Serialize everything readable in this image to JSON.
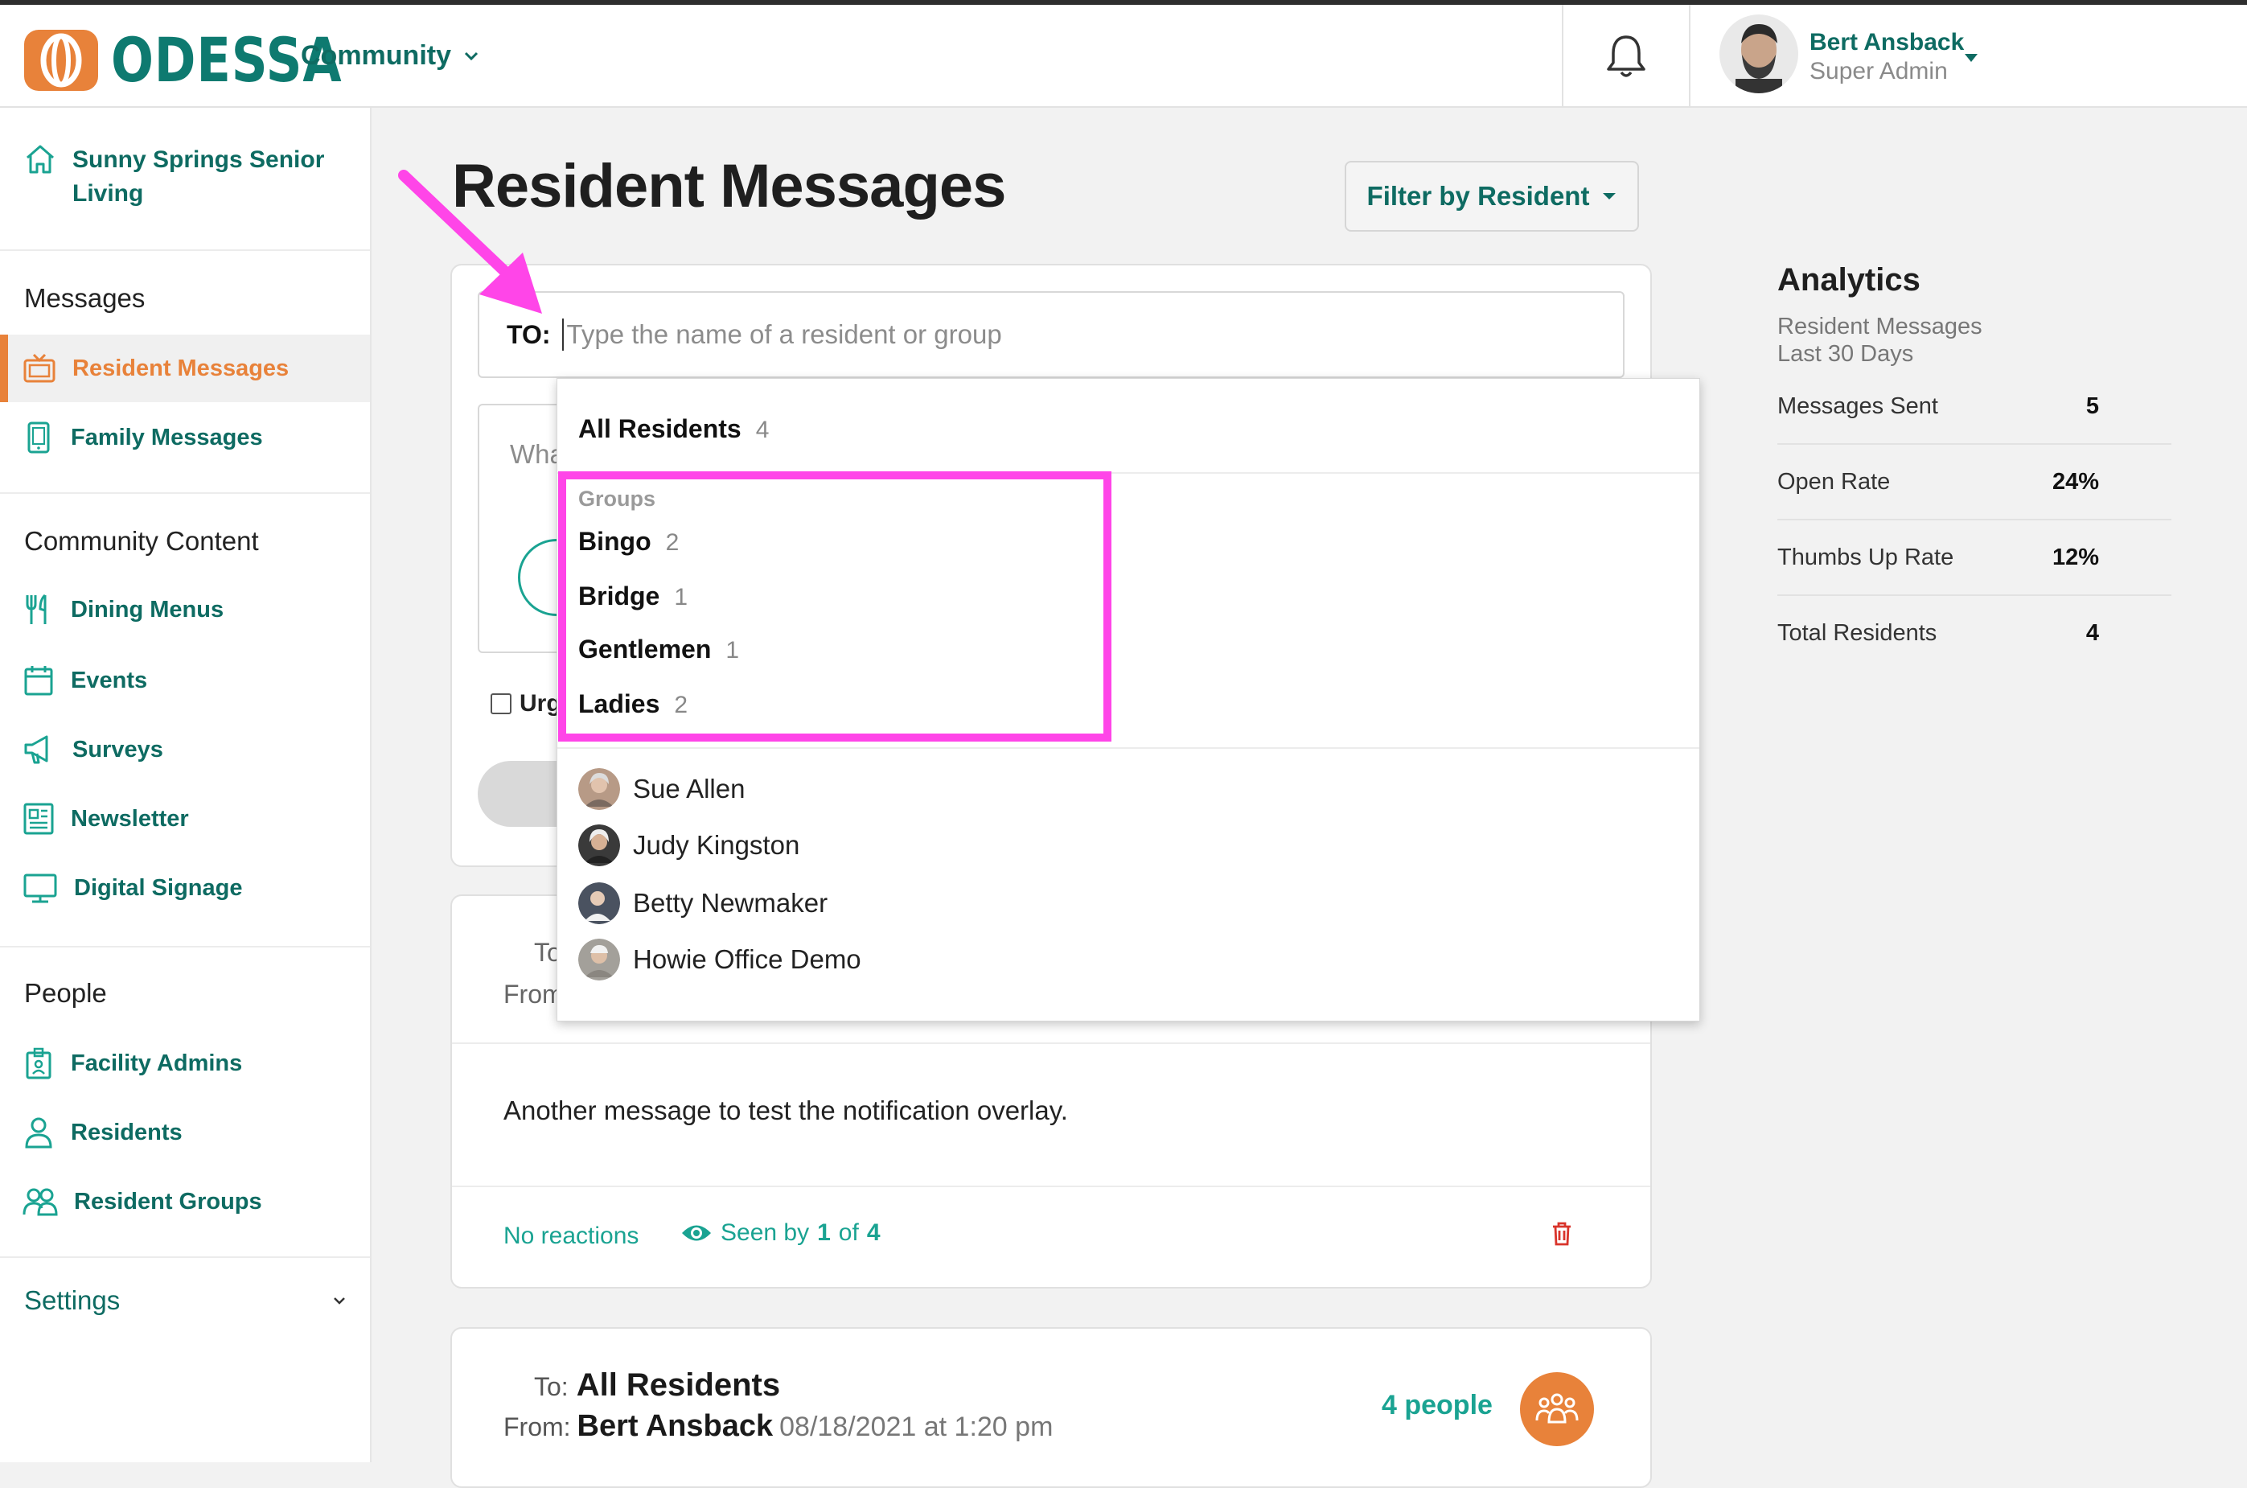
{
  "brand": {
    "name": "ODESSA",
    "community_menu": "Community"
  },
  "user": {
    "name": "Bert Ansback",
    "role": "Super Admin"
  },
  "sidebar": {
    "facility": "Sunny Springs Senior Living",
    "sections": {
      "messages": "Messages",
      "content": "Community Content",
      "people": "People",
      "settings": "Settings"
    },
    "items": {
      "resident_messages": "Resident Messages",
      "family_messages": "Family Messages",
      "dining_menus": "Dining Menus",
      "events": "Events",
      "surveys": "Surveys",
      "newsletter": "Newsletter",
      "digital_signage": "Digital Signage",
      "facility_admins": "Facility Admins",
      "residents": "Residents",
      "resident_groups": "Resident Groups"
    }
  },
  "main": {
    "title": "Resident Messages",
    "filter_button": "Filter by Resident",
    "compose": {
      "to_label": "TO:",
      "to_placeholder": "Type the name of a resident or group",
      "message_placeholder_partial": "Wha",
      "urgent_partial": "Urg"
    },
    "message1": {
      "to_partial": "To",
      "from_partial": "From",
      "body": "Another message to test the notification overlay.",
      "reactions": "No reactions",
      "seen_prefix": "Seen by",
      "seen_count": "1",
      "seen_of": "of",
      "seen_total": "4"
    },
    "message2": {
      "to_label": "To:",
      "to_value": "All Residents",
      "from_label": "From:",
      "from_value": "Bert Ansback",
      "timestamp": "08/18/2021 at 1:20 pm",
      "people": "4 people"
    }
  },
  "dropdown": {
    "all_label": "All Residents",
    "all_count": "4",
    "groups_label": "Groups",
    "groups": [
      {
        "name": "Bingo",
        "count": "2"
      },
      {
        "name": "Bridge",
        "count": "1"
      },
      {
        "name": "Gentlemen",
        "count": "1"
      },
      {
        "name": "Ladies",
        "count": "2"
      }
    ],
    "people": [
      {
        "name": "Sue Allen"
      },
      {
        "name": "Judy Kingston"
      },
      {
        "name": "Betty Newmaker"
      },
      {
        "name": "Howie Office Demo"
      }
    ]
  },
  "analytics": {
    "title": "Analytics",
    "subtitle1": "Resident Messages",
    "subtitle2": "Last 30 Days",
    "rows": [
      {
        "label": "Messages Sent",
        "value": "5"
      },
      {
        "label": "Open Rate",
        "value": "24%"
      },
      {
        "label": "Thumbs Up Rate",
        "value": "12%"
      },
      {
        "label": "Total Residents",
        "value": "4"
      }
    ]
  },
  "colors": {
    "brand_teal": "#0e6b62",
    "accent_orange": "#e8823a",
    "highlight_magenta": "#ff45e8"
  }
}
